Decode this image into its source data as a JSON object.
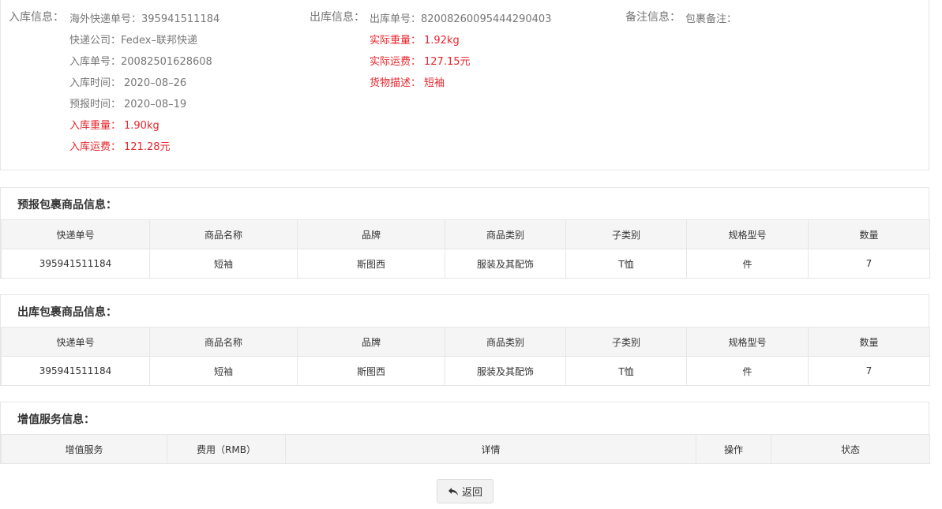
{
  "inbound": {
    "title": "入库信息：",
    "overseas_tracking_label": "海外快递单号：",
    "overseas_tracking_value": "395941511184",
    "courier_label": "快递公司：",
    "courier_value": "Fedex–联邦快递",
    "inbound_no_label": "入库单号：",
    "inbound_no_value": "20082501628608",
    "inbound_time_label": "入库时间：",
    "inbound_time_value": "2020–08–26",
    "forecast_time_label": "预报时间：",
    "forecast_time_value": "2020–08–19",
    "weight_label": "入库重量：",
    "weight_value": "1.90kg",
    "fee_label": "入库运费：",
    "fee_value": "121.28元"
  },
  "outbound": {
    "title": "出库信息：",
    "outbound_no_label": "出库单号：",
    "outbound_no_value": "82008260095444290403",
    "actual_weight_label": "实际重量：",
    "actual_weight_value": "1.92kg",
    "actual_fee_label": "实际运费：",
    "actual_fee_value": "127.15元",
    "goods_desc_label": "货物描述：",
    "goods_desc_value": "短袖"
  },
  "remark": {
    "title": "备注信息：",
    "package_remark_label": "包裹备注："
  },
  "forecast_goods": {
    "title": "预报包裹商品信息：",
    "columns": [
      "快递单号",
      "商品名称",
      "品牌",
      "商品类别",
      "子类别",
      "规格型号",
      "数量"
    ],
    "rows": [
      [
        "395941511184",
        "短袖",
        "斯图西",
        "服装及其配饰",
        "T恤",
        "件",
        "7"
      ]
    ]
  },
  "outbound_goods": {
    "title": "出库包裹商品信息：",
    "columns": [
      "快递单号",
      "商品名称",
      "品牌",
      "商品类别",
      "子类别",
      "规格型号",
      "数量"
    ],
    "rows": [
      [
        "395941511184",
        "短袖",
        "斯图西",
        "服装及其配饰",
        "T恤",
        "件",
        "7"
      ]
    ]
  },
  "value_added": {
    "title": "增值服务信息：",
    "columns": [
      "增值服务",
      "费用（RMB）",
      "详情",
      "操作",
      "状态"
    ]
  },
  "back_button": {
    "label": "返回",
    "icon": "reply-arrow-icon"
  },
  "colors": {
    "highlight_red": "#e8252c",
    "label_gray": "#777777",
    "border": "#e6e6e6",
    "header_bg": "#f5f5f5"
  }
}
